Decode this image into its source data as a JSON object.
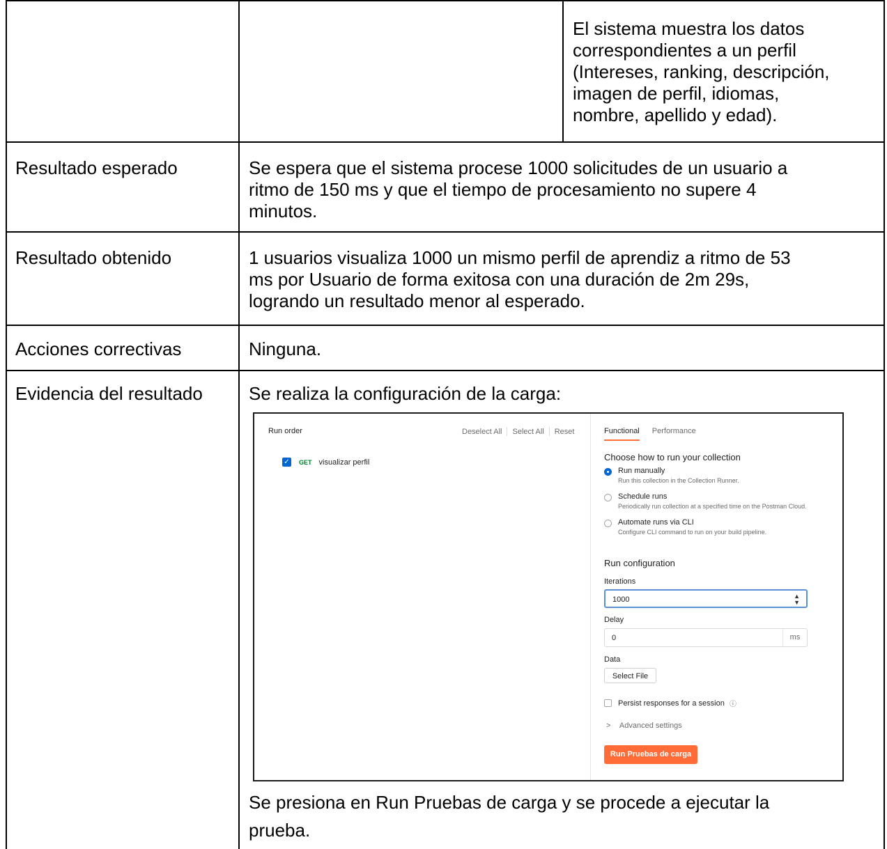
{
  "table": {
    "row1": {
      "right_cell": [
        "El sistema muestra los datos",
        "correspondientes a un perfil",
        "(Intereses, ranking, descripción,",
        "imagen de perfil, idiomas,",
        "nombre, apellido y edad)."
      ]
    },
    "row2": {
      "label": "Resultado esperado",
      "lines": [
        "Se espera que el sistema procese 1000 solicitudes de un usuario a",
        "ritmo de 150 ms y que el tiempo de procesamiento no supere 4",
        "minutos."
      ]
    },
    "row3": {
      "label": "Resultado obtenido",
      "lines": [
        "1 usuarios visualiza 1000 un mismo perfil de aprendiz a ritmo de 53",
        "ms por Usuario de forma exitosa con una duración de 2m 29s,",
        "logrando un resultado menor al esperado."
      ]
    },
    "row4": {
      "label": "Acciones correctivas",
      "text": "Ninguna."
    },
    "row5": {
      "label": "Evidencia del resultado",
      "intro": "Se realiza la configuración de la carga:",
      "outro_lines": [
        "Se  presiona en Run Pruebas de carga y se procede a ejecutar la",
        "prueba."
      ]
    }
  },
  "runner": {
    "run_order": "Run order",
    "deselect_all": "Deselect All",
    "select_all": "Select All",
    "reset": "Reset",
    "request": {
      "method": "GET",
      "name": "visualizar perfil",
      "checked": true
    },
    "tabs": [
      "Functional",
      "Performance"
    ],
    "choose_heading": "Choose how to run your collection",
    "options": [
      {
        "title": "Run manually",
        "desc": "Run this collection in the Collection Runner.",
        "selected": true
      },
      {
        "title": "Schedule runs",
        "desc": "Periodically run collection at a specified time on the Postman Cloud.",
        "selected": false
      },
      {
        "title": "Automate runs via CLI",
        "desc": "Configure CLI command to run on your build pipeline.",
        "selected": false
      }
    ],
    "config_heading": "Run configuration",
    "iterations_label": "Iterations",
    "iterations_value": "1000",
    "delay_label": "Delay",
    "delay_value": "0",
    "delay_unit": "ms",
    "data_label": "Data",
    "select_file": "Select File",
    "persist_label": "Persist responses for a session",
    "advanced": "Advanced settings",
    "run_button": "Run Pruebas de carga",
    "accent_color": "#ff6c37",
    "primary_color": "#0265d2"
  }
}
